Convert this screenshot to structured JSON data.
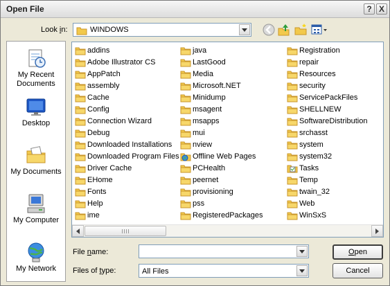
{
  "window": {
    "title": "Open File",
    "help_label": "?",
    "close_label": "X"
  },
  "lookin": {
    "label": "Look in:",
    "value": "WINDOWS"
  },
  "places": [
    {
      "label": "My Recent Documents",
      "icon": "recent-documents-icon"
    },
    {
      "label": "Desktop",
      "icon": "desktop-icon"
    },
    {
      "label": "My Documents",
      "icon": "my-documents-icon"
    },
    {
      "label": "My Computer",
      "icon": "my-computer-icon"
    },
    {
      "label": "My Network",
      "icon": "network-icon"
    }
  ],
  "files": [
    [
      "addins",
      "Adobe Illustrator CS",
      "AppPatch",
      "assembly",
      "Cache",
      "Config",
      "Connection Wizard",
      "Debug",
      "Downloaded Installations",
      "Downloaded Program Files",
      "Driver Cache",
      "EHome",
      "Fonts",
      "Help",
      "ime"
    ],
    [
      "java",
      "LastGood",
      "Media",
      "Microsoft.NET",
      "Minidump",
      "msagent",
      "msapps",
      "mui",
      "nview",
      "Offline Web Pages",
      "PCHealth",
      "peernet",
      "provisioning",
      "pss",
      "RegisteredPackages"
    ],
    [
      "Registration",
      "repair",
      "Resources",
      "security",
      "ServicePackFiles",
      "SHELLNEW",
      "SoftwareDistribution",
      "srchasst",
      "system",
      "system32",
      "Tasks",
      "Temp",
      "twain_32",
      "Web",
      "WinSxS"
    ]
  ],
  "special_icons": {
    "Offline Web Pages": "offline-folder-icon",
    "Tasks": "tasks-folder-icon"
  },
  "filename": {
    "label": "File name:",
    "value": "",
    "placeholder": ""
  },
  "filetype": {
    "label": "Files of type:",
    "value": "All Files"
  },
  "buttons": {
    "open": "Open",
    "cancel": "Cancel"
  },
  "colors": {
    "folder": "#f2c94c",
    "folder_edge": "#c9962a",
    "selection": "#316ac5"
  }
}
